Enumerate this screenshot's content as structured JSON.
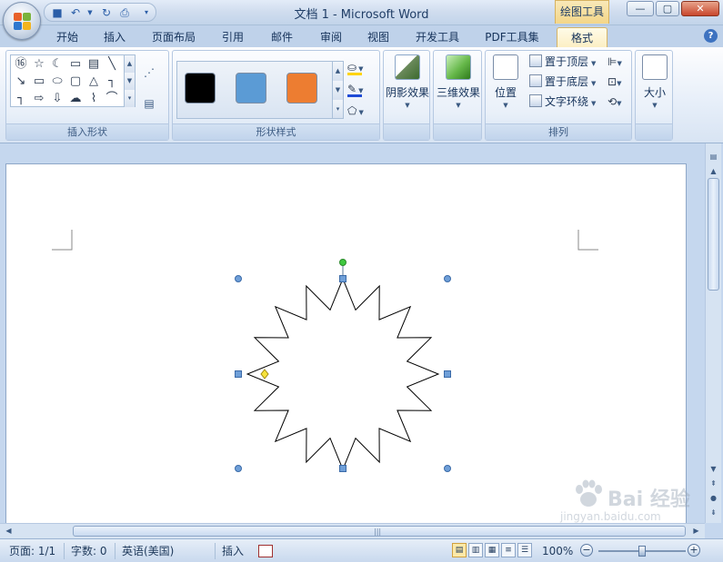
{
  "window": {
    "title": "文档 1 - Microsoft Word",
    "contextual_tab_group": "绘图工具",
    "minimize_icon": "minimize-icon",
    "maximize_icon": "maximize-icon",
    "close_icon": "close-icon"
  },
  "quick_access": {
    "items": [
      "save-icon",
      "undo-icon",
      "redo-icon",
      "print-preview-icon",
      "customize-qat-icon"
    ]
  },
  "tabs": [
    {
      "label": "开始",
      "active": false
    },
    {
      "label": "插入",
      "active": false
    },
    {
      "label": "页面布局",
      "active": false
    },
    {
      "label": "引用",
      "active": false
    },
    {
      "label": "邮件",
      "active": false
    },
    {
      "label": "审阅",
      "active": false
    },
    {
      "label": "视图",
      "active": false
    },
    {
      "label": "开发工具",
      "active": false
    },
    {
      "label": "PDF工具集",
      "active": false
    },
    {
      "label": "格式",
      "active": true
    }
  ],
  "ribbon": {
    "insert_shapes": {
      "label": "插入形状",
      "shapes": [
        "⑯",
        "☆",
        "☾",
        "▭",
        "▤",
        "╲",
        "↘",
        "▭",
        "⬭",
        "▢",
        "△",
        "┐",
        "┐",
        "⇨",
        "⇩",
        "☁",
        "⌇",
        "⌒"
      ]
    },
    "shape_styles": {
      "label": "形状样式",
      "swatches": [
        {
          "name": "black-style",
          "color": "#000000"
        },
        {
          "name": "blue-style",
          "color": "#5b9bd5"
        },
        {
          "name": "orange-style",
          "color": "#ed7d31"
        }
      ],
      "fill_color": "#ffd400",
      "outline_color": "#1f4bd6"
    },
    "shadow_effects": {
      "label": "阴影效果"
    },
    "effects_3d": {
      "label": "三维效果"
    },
    "arrange": {
      "label": "排列",
      "position_label": "位置",
      "bring_front_label": "置于顶层",
      "send_back_label": "置于底层",
      "text_wrap_label": "文字环绕"
    },
    "size": {
      "label": "大小"
    }
  },
  "document": {
    "shape": "16-point-star",
    "selected": true
  },
  "status": {
    "page": "页面: 1/1",
    "words": "字数: 0",
    "language": "英语(美国)",
    "mode": "插入",
    "zoom": "100%",
    "zoom_minus": "−",
    "zoom_plus": "+"
  },
  "watermark": {
    "text": "Bai 经验",
    "url": "jingyan.baidu.com"
  }
}
